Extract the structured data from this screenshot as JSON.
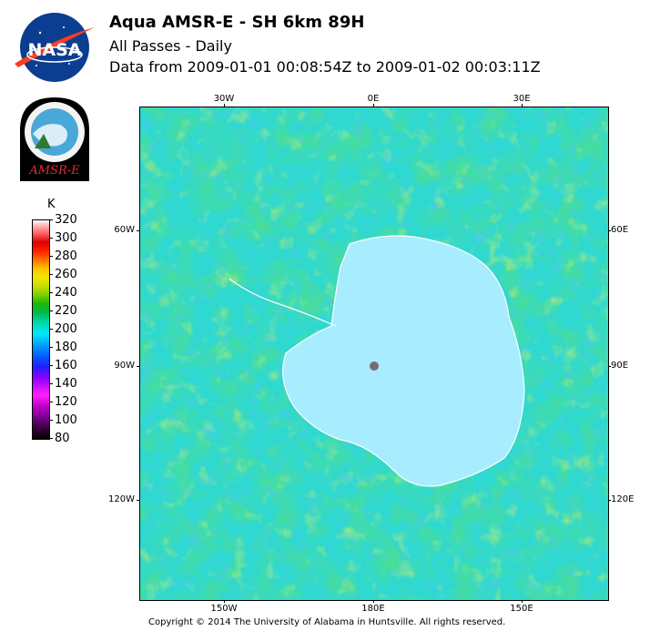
{
  "header": {
    "title": "Aqua AMSR-E - SH 6km 89H",
    "subtitle": "All Passes - Daily",
    "date_range": "Data from 2009-01-01 00:08:54Z to 2009-01-02 00:03:11Z"
  },
  "logos": {
    "nasa": {
      "icon": "nasa-meatball-logo",
      "text": "NASA",
      "colors": {
        "blue": "#0b3d91",
        "red": "#fc3d21"
      }
    },
    "amsr": {
      "icon": "amsr-e-mission-patch",
      "text": "AMSR-E"
    }
  },
  "colorbar": {
    "unit": "K",
    "labels": [
      "320",
      "300",
      "280",
      "260",
      "240",
      "220",
      "200",
      "180",
      "160",
      "140",
      "120",
      "100",
      "80"
    ],
    "min": 80,
    "max": 320
  },
  "map": {
    "projection": "south-polar-stereographic",
    "top_labels": [
      "30W",
      "0E",
      "30E"
    ],
    "bottom_labels": [
      "150W",
      "180E",
      "150E"
    ],
    "left_labels": [
      "60W",
      "90W",
      "120W"
    ],
    "right_labels": [
      "60E",
      "90E",
      "120E"
    ],
    "colors": {
      "ocean_cyan": "#2fd8d0",
      "land_ice": "#a0f0ff",
      "coastline": "#ffffff",
      "pole_marker": "#7a6a78"
    }
  },
  "footer": {
    "copyright": "Copyright © 2014 The University of Alabama in Huntsville. All rights reserved."
  }
}
